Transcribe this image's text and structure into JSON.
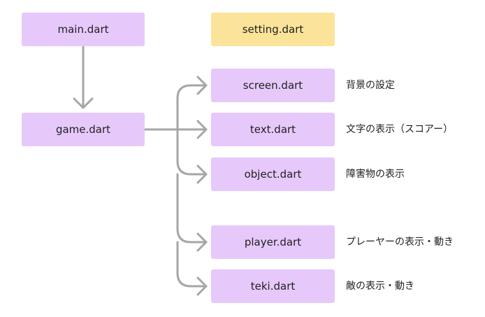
{
  "colors": {
    "node_fill": "#e6c9fa",
    "highlight_fill": "#fbe49a",
    "connector": "#a6a6a6",
    "text": "#1f1f1f"
  },
  "nodes": {
    "main": "main.dart",
    "setting": "setting.dart",
    "game": "game.dart",
    "screen": "screen.dart",
    "text": "text.dart",
    "object": "object.dart",
    "player": "player.dart",
    "teki": "teki.dart"
  },
  "descriptions": {
    "screen": "背景の設定",
    "text": "文字の表示（スコアー）",
    "object": "障害物の表示",
    "player": "プレーヤーの表示・動き",
    "teki": "敵の表示・動き"
  }
}
